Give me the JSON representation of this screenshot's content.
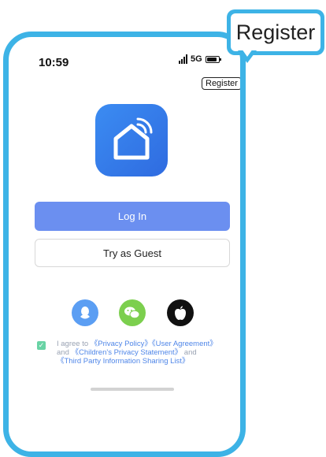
{
  "status_bar": {
    "time": "10:59",
    "network": "5G"
  },
  "header": {
    "register_label": "Register"
  },
  "buttons": {
    "login_label": "Log In",
    "guest_label": "Try as Guest"
  },
  "social": {
    "icons": [
      "qq-icon",
      "wechat-icon",
      "apple-icon"
    ]
  },
  "agreement": {
    "checked": true,
    "prefix": "I agree to ",
    "privacy_policy": "《Privacy Policy》",
    "user_agreement": "《User Agreement》",
    "and1": " and ",
    "children_privacy": "《Children's Privacy Statement》",
    "and2": " and ",
    "third_party": "《Third Party Information Sharing List》"
  },
  "callout": {
    "label": "Register"
  },
  "colors": {
    "accent": "#3db3e6",
    "login": "#6b8ff0",
    "link": "#4f86e8"
  }
}
